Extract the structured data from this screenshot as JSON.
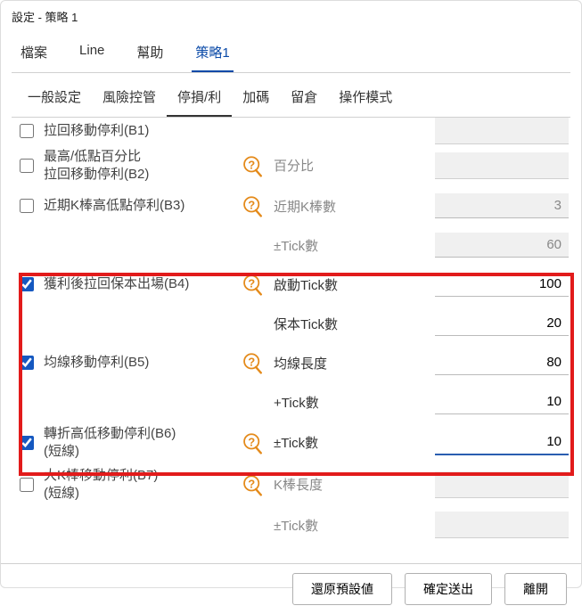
{
  "window": {
    "title": "設定 - 策略 1"
  },
  "menu": {
    "items": [
      "檔案",
      "Line",
      "幫助",
      "策略1"
    ],
    "active": "策略1"
  },
  "subtabs": {
    "items": [
      "一般設定",
      "風險控管",
      "停損/利",
      "加碼",
      "留倉",
      "操作模式"
    ],
    "active": "停損/利"
  },
  "rows": {
    "b1": {
      "checked": false,
      "label": "拉回移動停利(B1)"
    },
    "b2": {
      "checked": false,
      "label": "最高/低點百分比\n拉回移動停利(B2)",
      "param": "百分比"
    },
    "b3": {
      "checked": false,
      "label": "近期K棒高低點停利(B3)",
      "param": "近期K棒數",
      "value": "3"
    },
    "b3_extra": {
      "param": "±Tick數",
      "value": "60"
    },
    "b4": {
      "checked": true,
      "label": "獲利後拉回保本出場(B4)",
      "param": "啟動Tick數",
      "value": "100"
    },
    "b4_extra": {
      "param": "保本Tick數",
      "value": "20"
    },
    "b5": {
      "checked": true,
      "label": "均線移動停利(B5)",
      "param": "均線長度",
      "value": "80"
    },
    "b5_extra": {
      "param": "+Tick數",
      "value": "10"
    },
    "b6": {
      "checked": true,
      "label": "轉折高低移動停利(B6)\n(短線)",
      "param": "±Tick數",
      "value": "10"
    },
    "b7": {
      "checked": false,
      "label": "大K棒移動停利(B7)\n(短線)",
      "param": "K棒長度"
    },
    "b7_extra": {
      "param": "±Tick數"
    }
  },
  "footer": {
    "restore": "還原預設値",
    "confirm": "確定送出",
    "close": "離開"
  }
}
